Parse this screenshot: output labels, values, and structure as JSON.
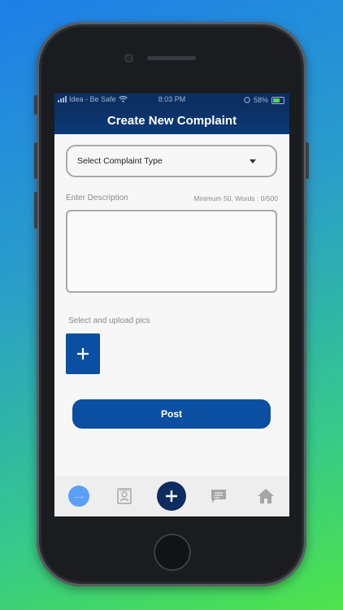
{
  "status_bar": {
    "carrier": "Idea - Be Safe",
    "time": "8:03 PM",
    "battery": "58%"
  },
  "header": {
    "title": "Create New Complaint"
  },
  "form": {
    "complaint_type_placeholder": "Select Complaint Type",
    "description_label": "Enter Description",
    "description_counter": "Minimum 50, Words : 0/500",
    "upload_label": "Select and upload pics",
    "post_label": "Post"
  },
  "tabbar": {
    "more_glyph": "....",
    "items": [
      {
        "icon": "more-icon"
      },
      {
        "icon": "profile-card-icon"
      },
      {
        "icon": "add-icon"
      },
      {
        "icon": "chat-icon"
      },
      {
        "icon": "home-icon"
      }
    ]
  },
  "colors": {
    "primary": "#0b4fa3",
    "header": "#0c2f63",
    "fab": "#0d2c5f",
    "more_bubble": "#5b9ef7"
  }
}
